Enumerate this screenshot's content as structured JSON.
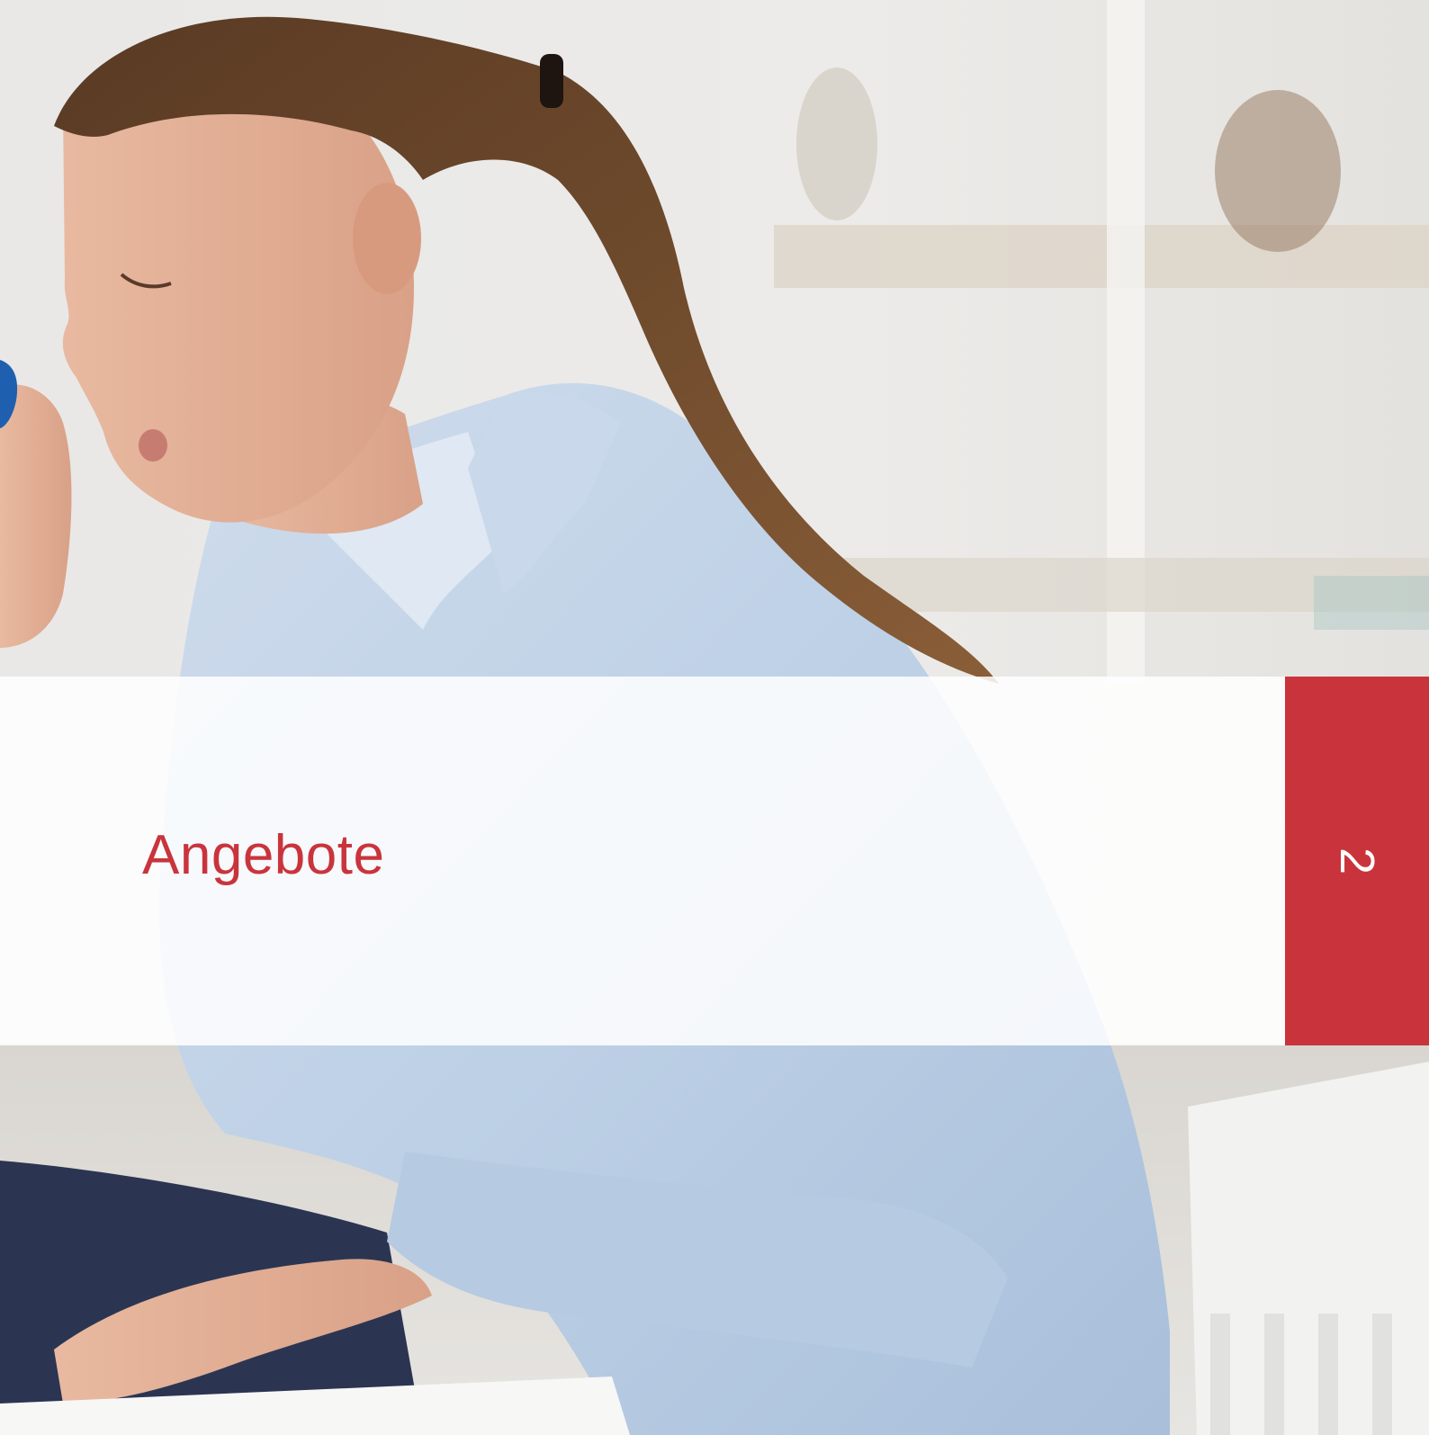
{
  "section": {
    "title": "Angebote",
    "number": "2"
  },
  "colors": {
    "accent": "#c9343c",
    "band": "#ffffff",
    "tab_text": "#ffffff"
  },
  "photo": {
    "alt": "",
    "icon": "photograph-of-woman-using-peak-flow-meter"
  }
}
